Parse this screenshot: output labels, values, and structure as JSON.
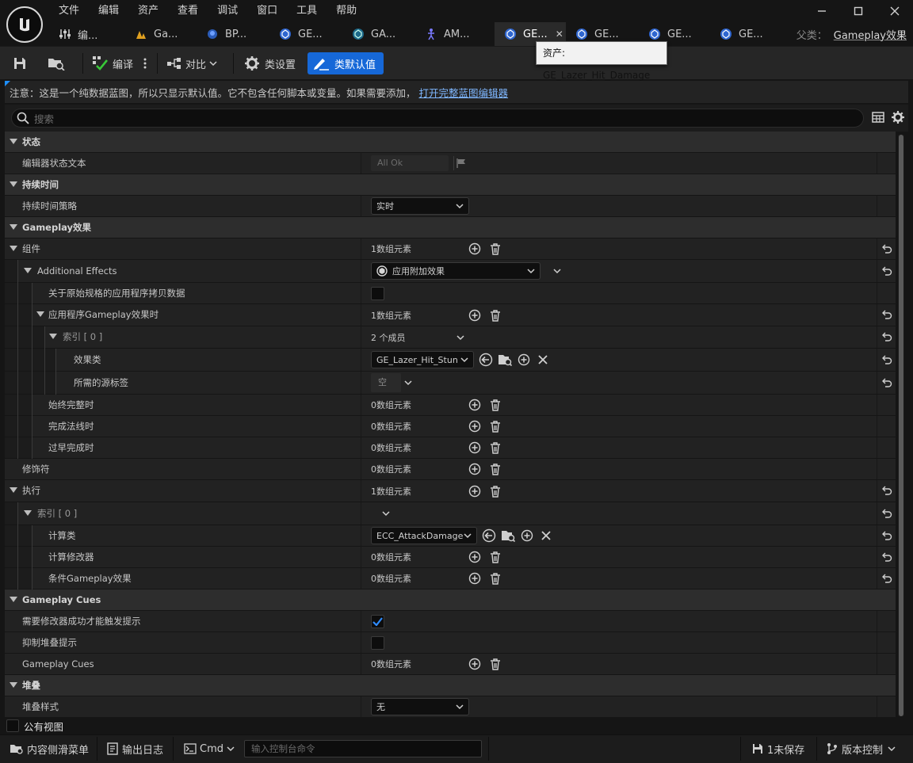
{
  "menu": [
    "文件",
    "编辑",
    "资产",
    "查看",
    "调试",
    "窗口",
    "工具",
    "帮助"
  ],
  "tabs": [
    {
      "label": "编...",
      "icon": "sliders-icon"
    },
    {
      "label": "Ga...",
      "icon": "anim-icon"
    },
    {
      "label": "BP...",
      "icon": "blueprint-icon"
    },
    {
      "label": "GE...",
      "icon": "gameplay-effect-icon"
    },
    {
      "label": "GA...",
      "icon": "gameplay-ability-icon"
    },
    {
      "label": "AM...",
      "icon": "montage-icon"
    },
    {
      "label": "GE...",
      "icon": "gameplay-effect-icon",
      "active": true
    },
    {
      "label": "GE...",
      "icon": "gameplay-effect-icon"
    },
    {
      "label": "GE...",
      "icon": "gameplay-effect-icon"
    },
    {
      "label": "GE...",
      "icon": "gameplay-effect-icon"
    }
  ],
  "parent": {
    "label": "父类：",
    "value": "Gameplay效果"
  },
  "tooltip": "资产: GE_Lazer_Hit_Damage",
  "toolbar": {
    "compile": "编译",
    "diff": "对比",
    "class_settings": "类设置",
    "class_defaults": "类默认值"
  },
  "notice": {
    "text": "注意：这是一个纯数据蓝图，所以只显示默认值。它不包含任何脚本或变量。如果需要添加，",
    "link": "打开完整蓝图编辑器"
  },
  "search": {
    "placeholder": "搜索"
  },
  "rows": [
    {
      "label": "状态"
    },
    {
      "label": "编辑器状态文本",
      "value": "All Ok"
    },
    {
      "label": "持续时间"
    },
    {
      "label": "持续时间策略",
      "value": "实时"
    },
    {
      "label": "Gameplay效果"
    },
    {
      "label": "组件",
      "value": "1数组元素"
    },
    {
      "label": "Additional Effects",
      "value": "应用附加效果"
    },
    {
      "label": "关于原始规格的应用程序拷贝数据"
    },
    {
      "label": "应用程序Gameplay效果时",
      "value": "1数组元素"
    },
    {
      "label": "索引 [ 0 ]",
      "value": "2 个成员"
    },
    {
      "label": "效果类",
      "value": "GE_Lazer_Hit_Stun"
    },
    {
      "label": "所需的源标签",
      "value": "空"
    },
    {
      "label": "始终完整时",
      "value": "0数组元素"
    },
    {
      "label": "完成法线时",
      "value": "0数组元素"
    },
    {
      "label": "过早完成时",
      "value": "0数组元素"
    },
    {
      "label": "修饰符",
      "value": "0数组元素"
    },
    {
      "label": "执行",
      "value": "1数组元素"
    },
    {
      "label": "索引 [ 0 ]"
    },
    {
      "label": "计算类",
      "value": "ECC_AttackDamage"
    },
    {
      "label": "计算修改器",
      "value": "0数组元素"
    },
    {
      "label": "条件Gameplay效果",
      "value": "0数组元素"
    },
    {
      "label": "Gameplay Cues"
    },
    {
      "label": "需要修改器成功才能触发提示"
    },
    {
      "label": "抑制堆叠提示"
    },
    {
      "label": "Gameplay Cues",
      "value": "0数组元素"
    },
    {
      "label": "堆叠"
    },
    {
      "label": "堆叠样式",
      "value": "无"
    }
  ],
  "public_view": "公有视图",
  "status": {
    "content_drawer": "内容侧滑菜单",
    "output_log": "输出日志",
    "cmd": "Cmd",
    "cmd_placeholder": "输入控制台命令",
    "unsaved": "1未保存",
    "source_control": "版本控制"
  },
  "colors": {
    "accent": "#1668d8",
    "link": "#7fb7ff",
    "background": "#151515"
  }
}
